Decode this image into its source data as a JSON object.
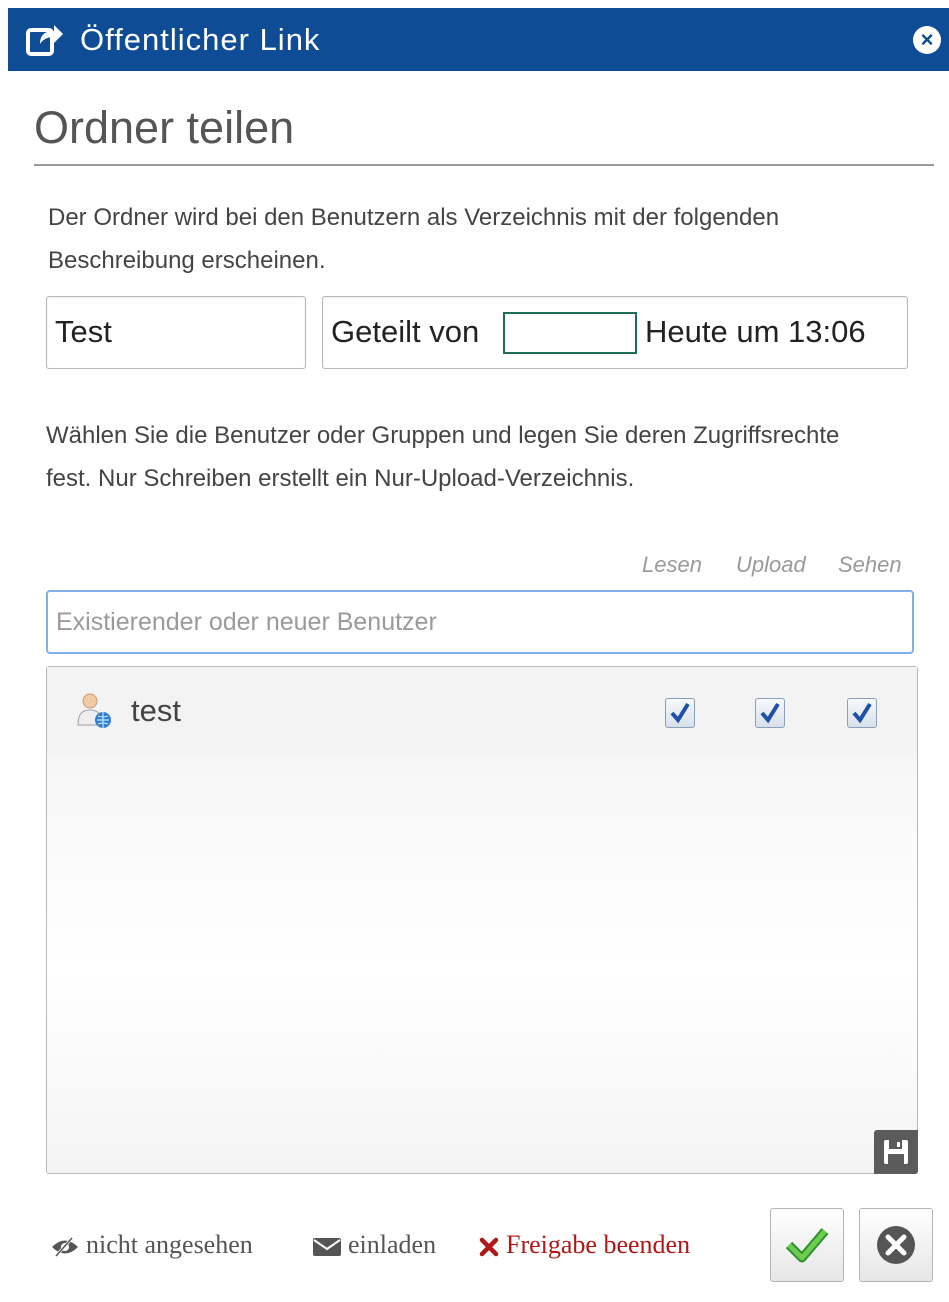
{
  "dialog": {
    "title": "Öffentlicher Link",
    "close_symbol": "×"
  },
  "heading": "Ordner teilen",
  "description": "Der Ordner wird bei den Benutzern als Verzeichnis mit der folgenden Beschreibung erscheinen.",
  "share": {
    "name_value": "Test",
    "shared_by_label": "Geteilt von",
    "owner_value": "",
    "date_text": "Heute um 13:06"
  },
  "instructions": "Wählen Sie die Benutzer oder Gruppen und legen Sie deren Zugriffsrechte fest. Nur Schreiben erstellt ein Nur-Upload-Verzeichnis.",
  "columns": {
    "read": "Lesen",
    "upload": "Upload",
    "see": "Sehen"
  },
  "search": {
    "placeholder": "Existierender oder neuer Benutzer",
    "value": ""
  },
  "users": [
    {
      "name": "test",
      "icon": "user-globe-icon",
      "read": true,
      "upload": true,
      "see": true
    }
  ],
  "footer": {
    "not_viewed": "nicht angesehen",
    "invite": "einladen",
    "end_share": "Freigabe beenden"
  },
  "colors": {
    "titlebar": "#0f4c96",
    "end_share": "#b01818",
    "confirm": "#3aa53a"
  }
}
